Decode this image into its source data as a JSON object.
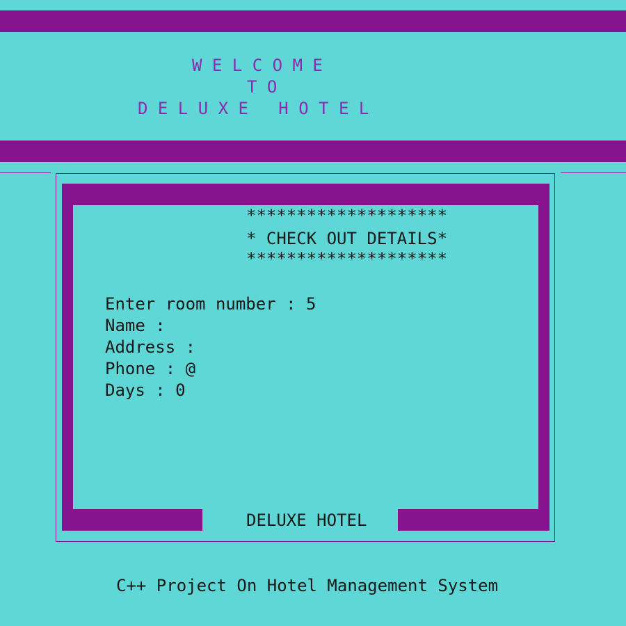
{
  "banner": {
    "line1": "W E L C O M E",
    "line2": "T O",
    "line3": "D E L U X E   H O T E L"
  },
  "panel": {
    "stars_top": "********************",
    "heading": "* CHECK OUT DETAILS*",
    "stars_bottom": "********************",
    "footer_label": "DELUXE HOTEL"
  },
  "form": {
    "fields": [
      {
        "label": "Enter room number",
        "value": "5"
      },
      {
        "label": "Name",
        "value": ""
      },
      {
        "label": "Address",
        "value": ""
      },
      {
        "label": "Phone",
        "value": "@"
      },
      {
        "label": "Days",
        "value": "0"
      }
    ]
  },
  "footer": {
    "text": "C++ Project On Hotel Management System"
  },
  "colors": {
    "background": "#5fd7d7",
    "accent": "#87148f",
    "banner_text": "#8a2cb0",
    "text": "#1a1a1a"
  }
}
